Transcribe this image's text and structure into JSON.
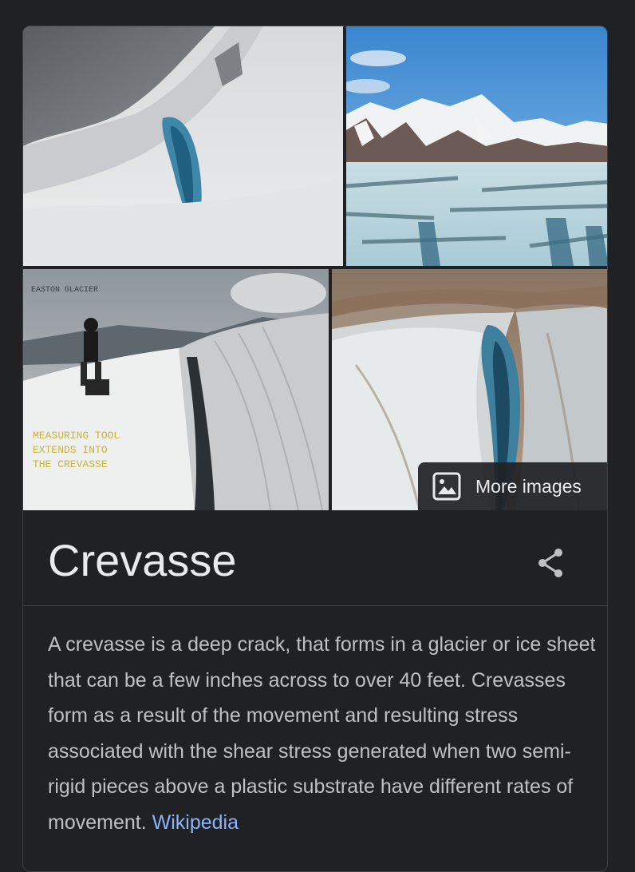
{
  "gallery": {
    "images": [
      {
        "icon": "crevasse-snow-slope-image"
      },
      {
        "icon": "glacier-mountains-image"
      },
      {
        "icon": "easton-glacier-measuring-image",
        "caption_top": "EASTON GLACIER",
        "caption_lines": [
          "MEASURING TOOL",
          "EXTENDS INTO",
          "THE CREVASSE"
        ]
      },
      {
        "icon": "deep-crevasse-closeup-image"
      }
    ],
    "more_images_label": "More images",
    "more_images_icon": "image-icon"
  },
  "entity": {
    "title": "Crevasse",
    "share_icon": "share-icon"
  },
  "description": {
    "text": "A crevasse is a deep crack, that forms in a glacier or ice sheet that can be a few inches across to over 40 feet. Crevasses form as a result of the movement and resulting stress associated with the shear stress generated when two semi-rigid pieces above a plastic substrate have different rates of movement.",
    "source_link": "Wikipedia"
  },
  "colors": {
    "background": "#202124",
    "text": "#e8eaed",
    "body_text": "#bdc1c6",
    "link": "#8ab4f8"
  }
}
